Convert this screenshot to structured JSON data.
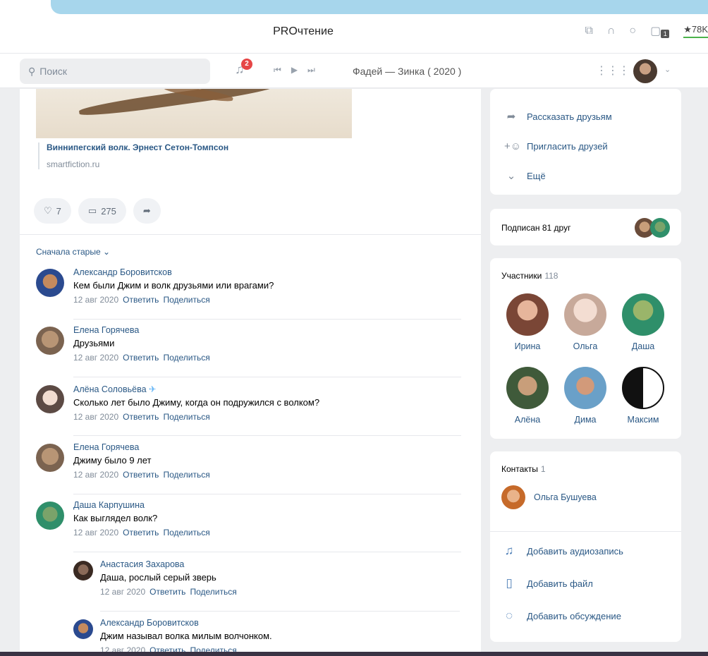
{
  "browser": {
    "title": "PROчтение",
    "rating": "★78K",
    "tab_badge": "1"
  },
  "header": {
    "search_placeholder": "Поиск",
    "notif_count": "2",
    "track": "Фадей — Зинка ( 2020 )"
  },
  "post": {
    "link_title": "Виннипегский волк. Эрнест Сетон-Томпсон",
    "link_domain": "smartfiction.ru",
    "likes": "7",
    "comments": "275"
  },
  "comments": {
    "sort_label": "Сначала старые",
    "reply_label": "Ответить",
    "share_label": "Поделиться",
    "items": [
      {
        "name": "Александр Боровитсков",
        "text": "Кем были Джим и волк друзьями или врагами?",
        "date": "12 авг 2020"
      },
      {
        "name": "Елена Горячева",
        "text": "Друзьями",
        "date": "12 авг 2020"
      },
      {
        "name": "Алёна Соловьёва",
        "text": "Сколько лет было Джиму, когда он подружился с волком?",
        "date": "12 авг 2020"
      },
      {
        "name": "Елена Горячева",
        "text": "Джиму было 9 лет",
        "date": "12 авг 2020"
      },
      {
        "name": "Даша Карпушина",
        "text": "Как выглядел волк?",
        "date": "12 авг 2020"
      },
      {
        "name": "Анастасия Захарова",
        "text": "Даша, рослый серый зверь",
        "date": "12 авг 2020"
      },
      {
        "name": "Александр Боровитсков",
        "text": "Джим называл волка милым волчонком.",
        "date": "12 авг 2020"
      }
    ]
  },
  "sidebar": {
    "share_label": "Рассказать друзьям",
    "invite_label": "Пригласить друзей",
    "more_label": "Ещё",
    "subscribed_label": "Подписан 81 друг",
    "members_title": "Участники",
    "members_count": "118",
    "members": [
      "Ирина",
      "Ольга",
      "Даша",
      "Алёна",
      "Дима",
      "Максим"
    ],
    "contacts_title": "Контакты",
    "contacts_count": "1",
    "contact_name": "Ольга Бушуева",
    "add_audio": "Добавить аудиозапись",
    "add_file": "Добавить файл",
    "add_discussion": "Добавить обсуждение"
  }
}
